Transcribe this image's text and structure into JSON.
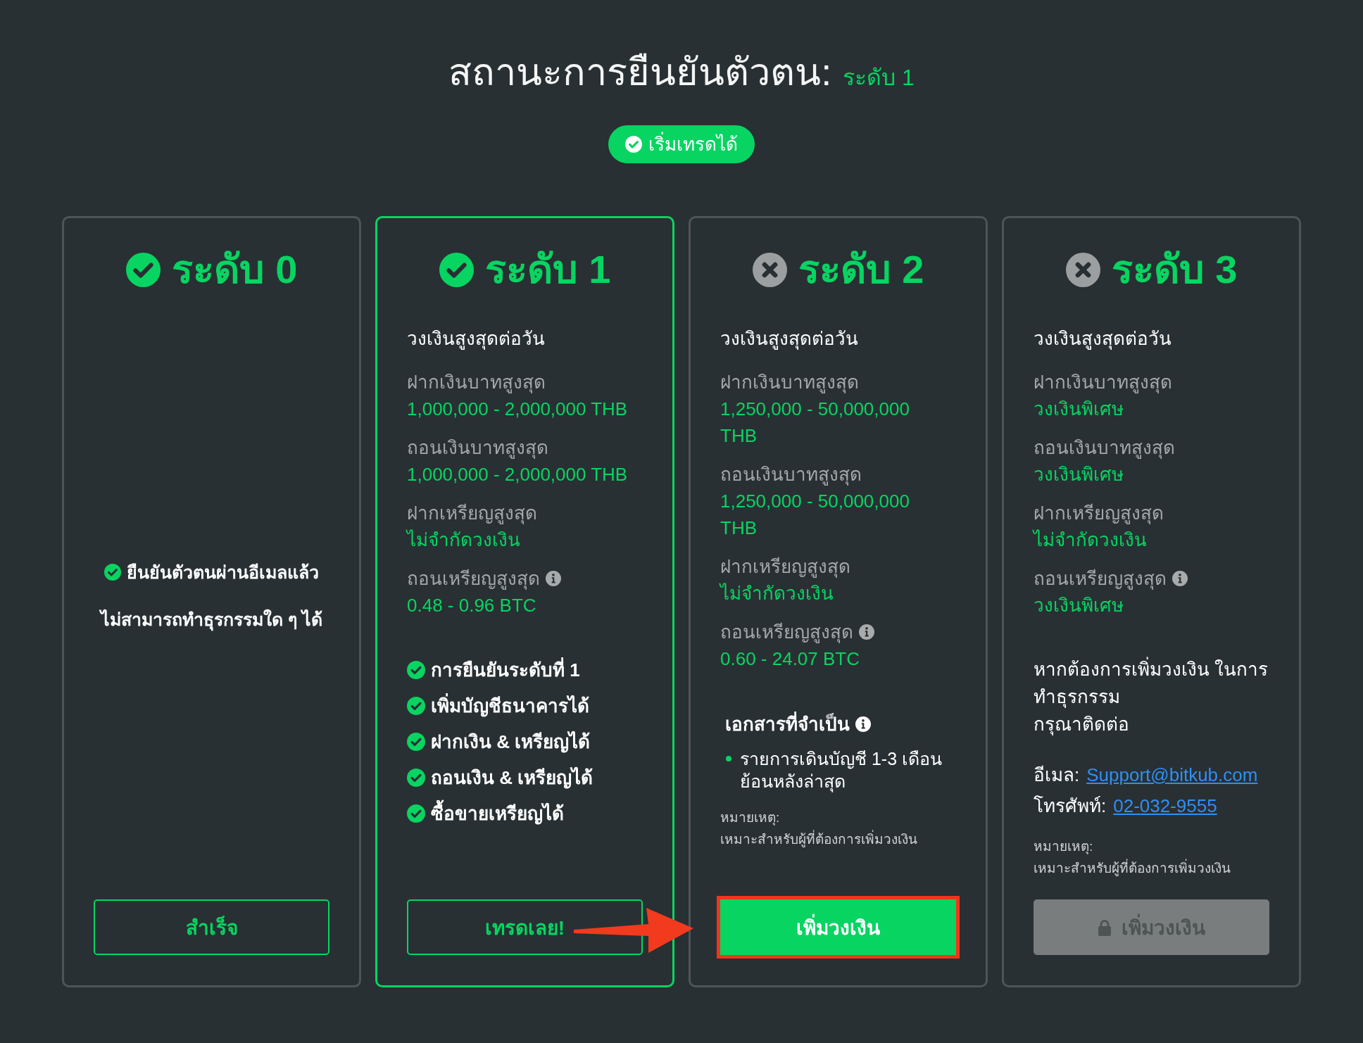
{
  "title": {
    "text": "สถานะการยืนยันตัวตน:",
    "current_level": "ระดับ 1"
  },
  "status_badge": {
    "label": "เริ่มเทรดได้"
  },
  "tiers": [
    {
      "name": "ระดับ 0",
      "verified": true,
      "current": false,
      "messages": [
        {
          "kind": "check",
          "text": "ยืนยันตัวตนผ่านอีเมลแล้ว"
        },
        {
          "kind": "plain",
          "text": "ไม่สามารถทำธุรกรรมใด ๆ ได้"
        }
      ],
      "button": {
        "label": "สำเร็จ",
        "kind": "outline",
        "disabled": false,
        "highlighted": false
      }
    },
    {
      "name": "ระดับ 1",
      "verified": true,
      "current": true,
      "limits_title": "วงเงินสูงสุดต่อวัน",
      "limits": [
        {
          "label": "ฝากเงินบาทสูงสุด",
          "value": "1,000,000 - 2,000,000 THB",
          "info": false
        },
        {
          "label": "ถอนเงินบาทสูงสุด",
          "value": "1,000,000 - 2,000,000 THB",
          "info": false
        },
        {
          "label": "ฝากเหรียญสูงสุด",
          "value": "ไม่จำกัดวงเงิน",
          "info": false
        },
        {
          "label": "ถอนเหรียญสูงสุด",
          "value": "0.48 - 0.96 BTC",
          "info": true
        }
      ],
      "features": [
        "การยืนยันระดับที่ 1",
        "เพิ่มบัญชีธนาคารได้",
        "ฝากเงิน & เหรียญได้",
        "ถอนเงิน & เหรียญได้",
        "ซื้อขายเหรียญได้"
      ],
      "button": {
        "label": "เทรดเลย!",
        "kind": "outline",
        "disabled": false,
        "highlighted": false
      }
    },
    {
      "name": "ระดับ 2",
      "verified": false,
      "current": false,
      "limits_title": "วงเงินสูงสุดต่อวัน",
      "limits": [
        {
          "label": "ฝากเงินบาทสูงสุด",
          "value": "1,250,000 - 50,000,000 THB",
          "info": false
        },
        {
          "label": "ถอนเงินบาทสูงสุด",
          "value": "1,250,000 - 50,000,000 THB",
          "info": false
        },
        {
          "label": "ฝากเหรียญสูงสุด",
          "value": "ไม่จำกัดวงเงิน",
          "info": false
        },
        {
          "label": "ถอนเหรียญสูงสุด",
          "value": "0.60 - 24.07 BTC",
          "info": true
        }
      ],
      "documents": {
        "title": "เอกสารที่จำเป็น",
        "info": true,
        "items": [
          "รายการเดินบัญชี 1-3 เดือน ย้อนหลังล่าสุด"
        ]
      },
      "note": {
        "label": "หมายเหตุ:",
        "text": "เหมาะสำหรับผู้ที่ต้องการเพิ่มวงเงิน"
      },
      "button": {
        "label": "เพิ่มวงเงิน",
        "kind": "primary",
        "disabled": false,
        "highlighted": true
      }
    },
    {
      "name": "ระดับ 3",
      "verified": false,
      "current": false,
      "limits_title": "วงเงินสูงสุดต่อวัน",
      "limits": [
        {
          "label": "ฝากเงินบาทสูงสุด",
          "value": "วงเงินพิเศษ",
          "info": false
        },
        {
          "label": "ถอนเงินบาทสูงสุด",
          "value": "วงเงินพิเศษ",
          "info": false
        },
        {
          "label": "ฝากเหรียญสูงสุด",
          "value": "ไม่จำกัดวงเงิน",
          "info": false
        },
        {
          "label": "ถอนเหรียญสูงสุด",
          "value": "วงเงินพิเศษ",
          "info": true
        }
      ],
      "contact": {
        "text": "หากต้องการเพิ่มวงเงิน ในการทำธุรกรรม",
        "prompt": "กรุณาติดต่อ",
        "email_label": "อีเมล:",
        "email": "Support@bitkub.com",
        "phone_label": "โทรศัพท์:",
        "phone": "02-032-9555"
      },
      "note": {
        "label": "หมายเหตุ:",
        "text": "เหมาะสำหรับผู้ที่ต้องการเพิ่มวงเงิน"
      },
      "button": {
        "label": "เพิ่มวงเงิน",
        "kind": "primary",
        "disabled": true,
        "highlighted": false
      }
    }
  ],
  "arrow_annotation": true
}
